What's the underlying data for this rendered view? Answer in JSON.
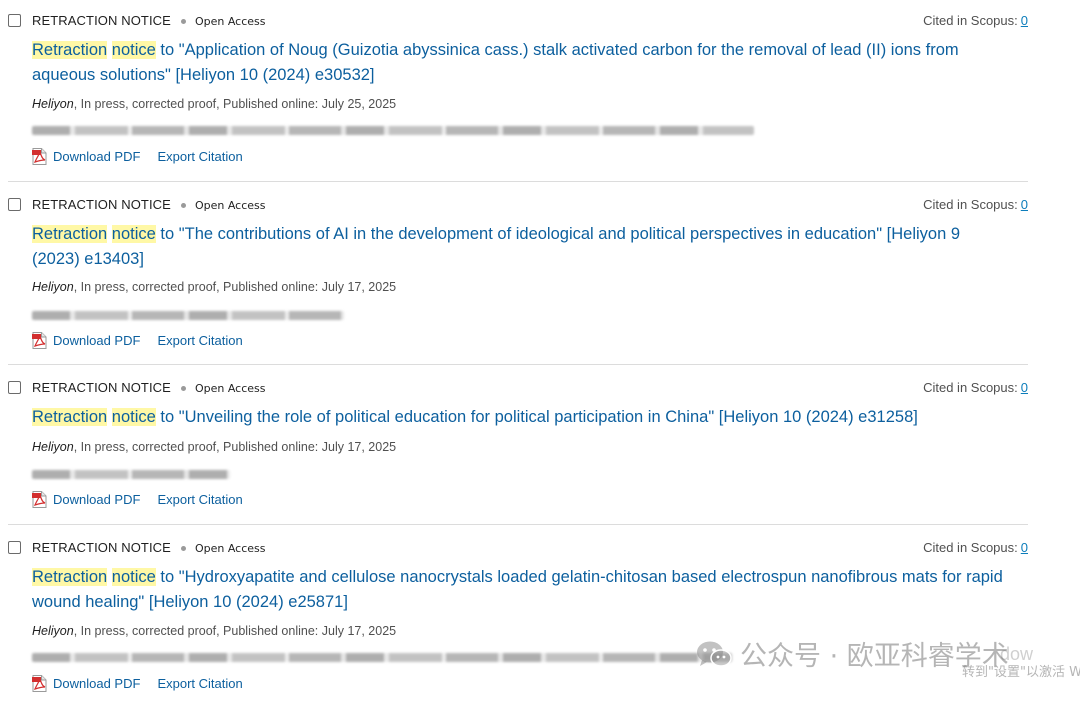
{
  "results": [
    {
      "doc_type": "RETRACTION NOTICE",
      "access": "Open Access",
      "cited_label": "Cited in Scopus:",
      "cited_count": "0",
      "title_hl1": "Retraction",
      "title_hl2": "notice",
      "title_rest": " to \"Application of Noug (Guizotia abyssinica cass.) stalk activated carbon for the removal of lead (II) ions from aqueous solutions\" [Heliyon 10 (2024) e30532]",
      "journal": "Heliyon",
      "source_rest": ", In press, corrected proof, Published online: July 25, 2025",
      "download_label": "Download PDF",
      "export_label": "Export Citation"
    },
    {
      "doc_type": "RETRACTION NOTICE",
      "access": "Open Access",
      "cited_label": "Cited in Scopus:",
      "cited_count": "0",
      "title_hl1": "Retraction",
      "title_hl2": "notice",
      "title_rest": " to \"The contributions of AI in the development of ideological and political perspectives in education\" [Heliyon 9 (2023) e13403]",
      "journal": "Heliyon",
      "source_rest": ", In press, corrected proof, Published online: July 17, 2025",
      "download_label": "Download PDF",
      "export_label": "Export Citation"
    },
    {
      "doc_type": "RETRACTION NOTICE",
      "access": "Open Access",
      "cited_label": "Cited in Scopus:",
      "cited_count": "0",
      "title_hl1": "Retraction",
      "title_hl2": "notice",
      "title_rest": " to \"Unveiling the role of political education for political participation in China\" [Heliyon 10 (2024) e31258]",
      "journal": "Heliyon",
      "source_rest": ", In press, corrected proof, Published online: July 17, 2025",
      "download_label": "Download PDF",
      "export_label": "Export Citation"
    },
    {
      "doc_type": "RETRACTION NOTICE",
      "access": "Open Access",
      "cited_label": "Cited in Scopus:",
      "cited_count": "0",
      "title_hl1": "Retraction",
      "title_hl2": "notice",
      "title_rest": " to \"Hydroxyapatite and cellulose nanocrystals loaded gelatin-chitosan based electrospun nanofibrous mats for rapid wound healing\" [Heliyon 10 (2024) e25871]",
      "journal": "Heliyon",
      "source_rest": ", In press, corrected proof, Published online: July 17, 2025",
      "download_label": "Download PDF",
      "export_label": "Export Citation"
    }
  ],
  "icons": {
    "pdf": "pdf-icon",
    "wechat": "wechat-icon"
  },
  "colors": {
    "link": "#0c5f9e",
    "highlight": "#fff8a6",
    "pdf_red": "#d32f2f"
  },
  "watermark": {
    "text": "公众号 · 欧亚科睿学术",
    "os_title": "dow",
    "os_hint": "转到\"设置\"以激活 W"
  }
}
